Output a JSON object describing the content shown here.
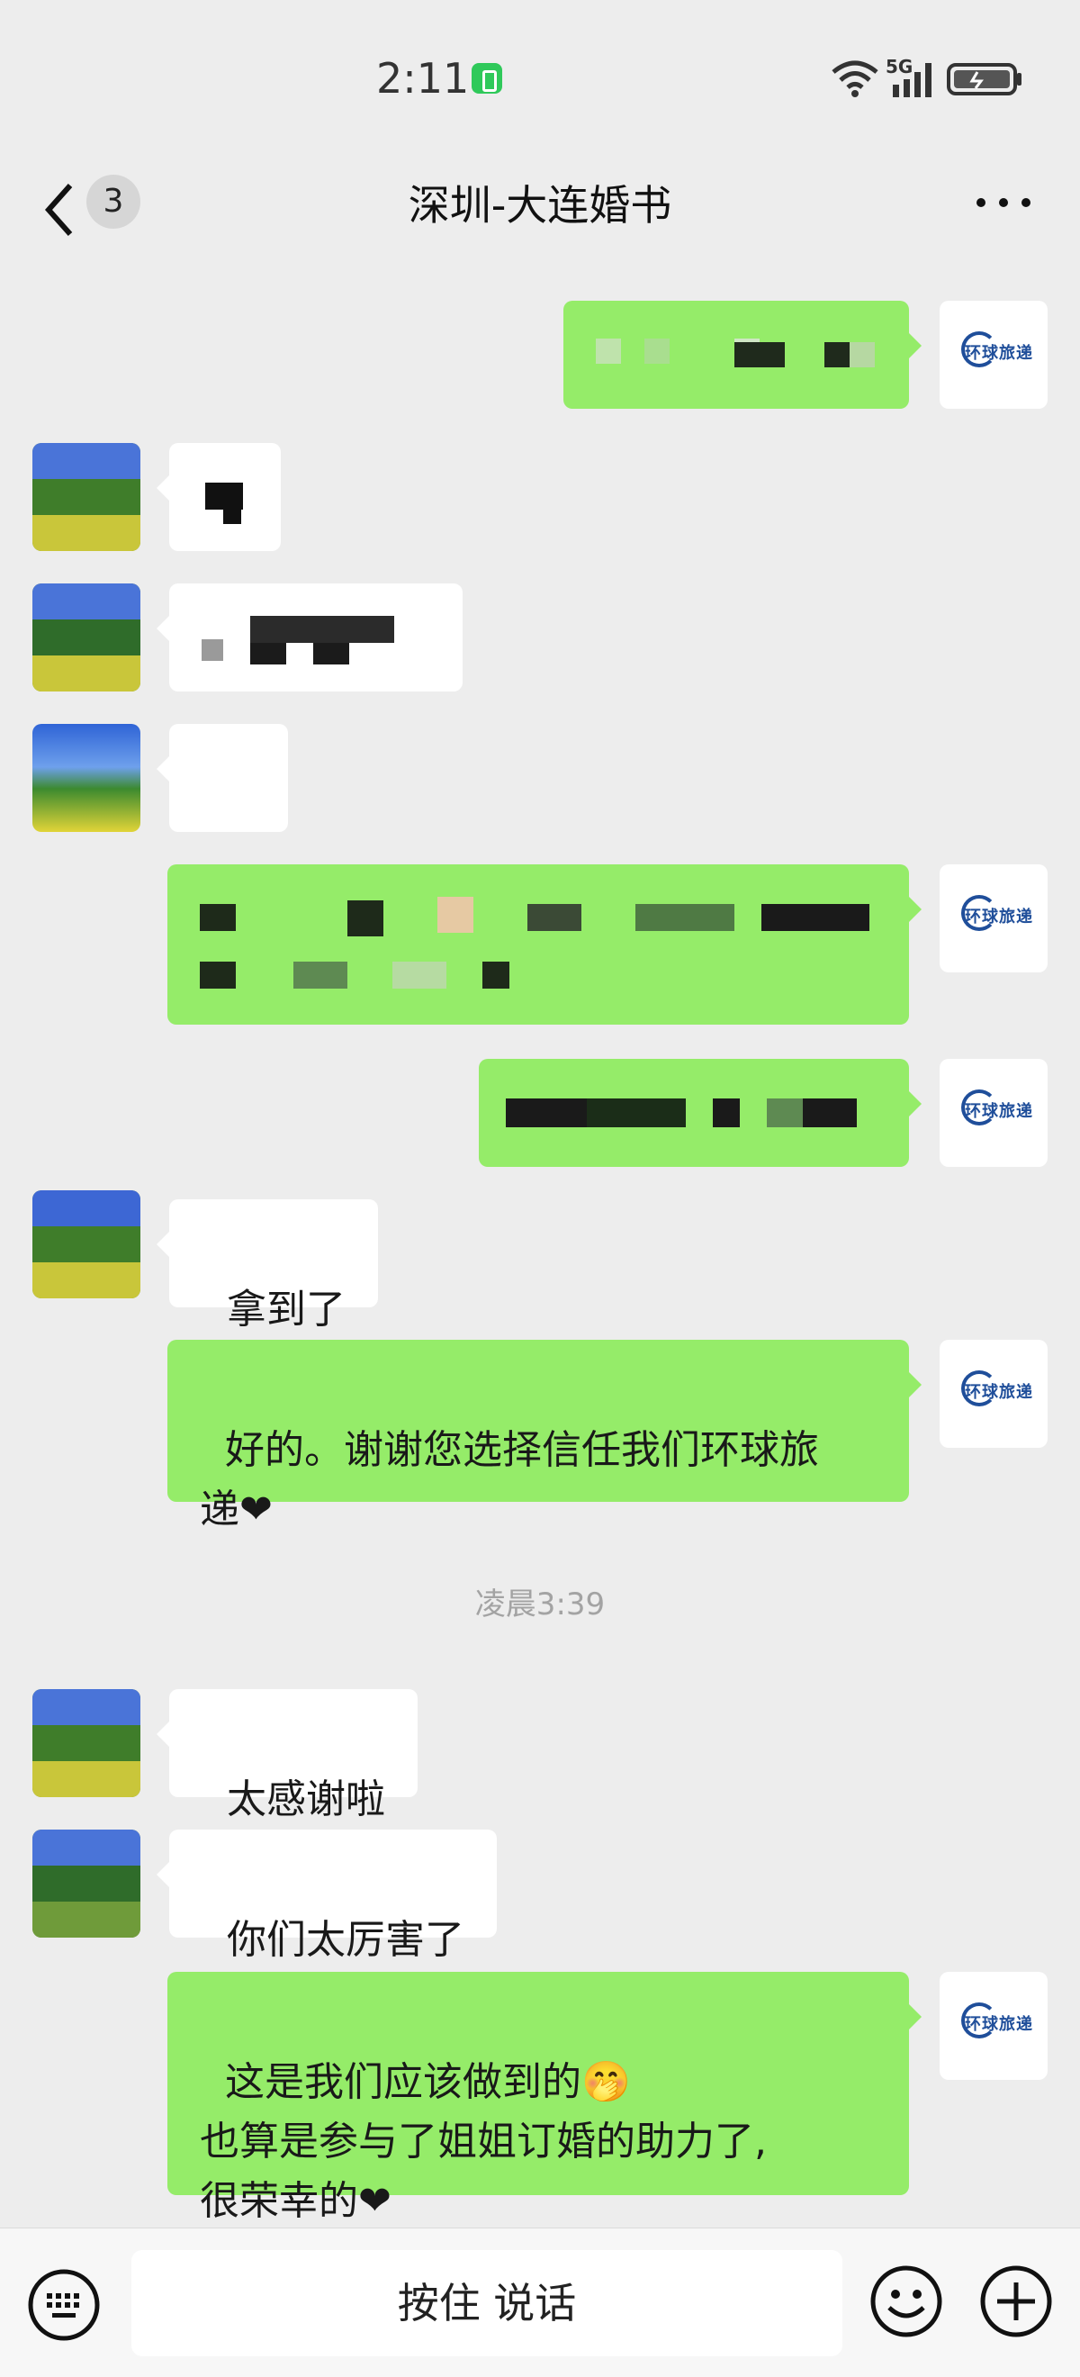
{
  "status_bar": {
    "time": "2:11",
    "network": "5G"
  },
  "header": {
    "unread_count": "3",
    "title": "深圳-大连婚书"
  },
  "messages": [
    {
      "side": "right",
      "text": ""
    },
    {
      "side": "left",
      "text": ""
    },
    {
      "side": "left",
      "text": ""
    },
    {
      "side": "left",
      "text": "😭"
    },
    {
      "side": "right",
      "text": ""
    },
    {
      "side": "right",
      "text": ""
    },
    {
      "side": "left",
      "text": "拿到了"
    },
    {
      "side": "right",
      "text": "好的。谢谢您选择信任我们环球旅\n递❤"
    },
    {
      "side": "left",
      "text": "太感谢啦"
    },
    {
      "side": "left",
      "text": "你们太厉害了"
    },
    {
      "side": "right",
      "text": "这是我们应该做到的🤭\n也算是参与了姐姐订婚的助力了,\n很荣幸的❤"
    }
  ],
  "timestamp": "凌晨3:39",
  "input_bar": {
    "voice_label": "按住 说话"
  },
  "colors": {
    "background": "#ededed",
    "bubble_right": "#95ec69",
    "bubble_left": "#ffffff",
    "logo_blue": "#1f4e9a"
  },
  "icons": [
    "wifi-icon",
    "signal-icon",
    "battery-icon",
    "back-icon",
    "more-icon",
    "keyboard-icon",
    "emoji-icon",
    "plus-icon"
  ]
}
